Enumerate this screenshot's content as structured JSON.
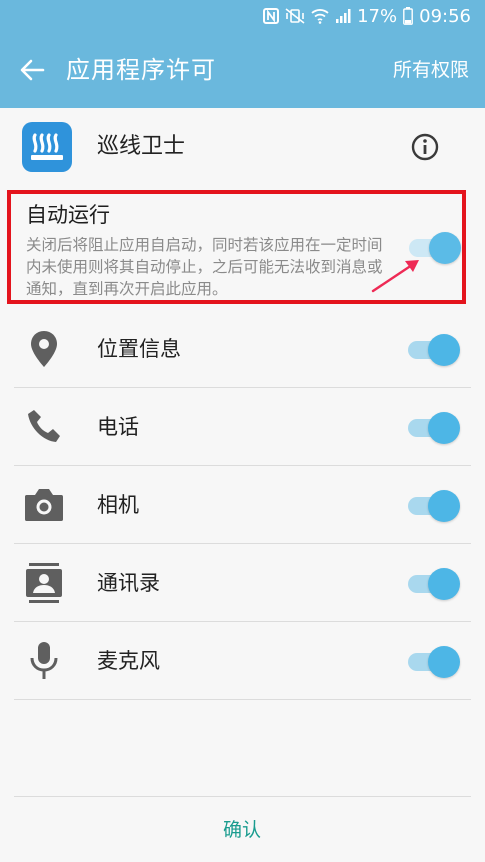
{
  "status_bar": {
    "battery_percent": "17%",
    "time": "09:56"
  },
  "app_bar": {
    "title": "应用程序许可",
    "action_label": "所有权限"
  },
  "app": {
    "name": "巡线卫士",
    "icon": "heater-icon",
    "icon_color": "#2f93db"
  },
  "auto_run": {
    "title": "自动运行",
    "description": "关闭后将阻止应用自启动，同时若该应用在一定时间内未使用则将其自动停止，之后可能无法收到消息或通知，直到再次开启此应用。",
    "enabled": true
  },
  "permissions": [
    {
      "label": "位置信息",
      "icon": "location-icon",
      "enabled": true
    },
    {
      "label": "电话",
      "icon": "phone-icon",
      "enabled": true
    },
    {
      "label": "相机",
      "icon": "camera-icon",
      "enabled": true
    },
    {
      "label": "通讯录",
      "icon": "contacts-icon",
      "enabled": true
    },
    {
      "label": "麦克风",
      "icon": "microphone-icon",
      "enabled": true
    }
  ],
  "confirm_label": "确认",
  "colors": {
    "accent": "#6ab8dd",
    "toggle_on": "#4db6e6",
    "highlight_border": "#e4141d",
    "confirm_text": "#1a9c8f"
  }
}
